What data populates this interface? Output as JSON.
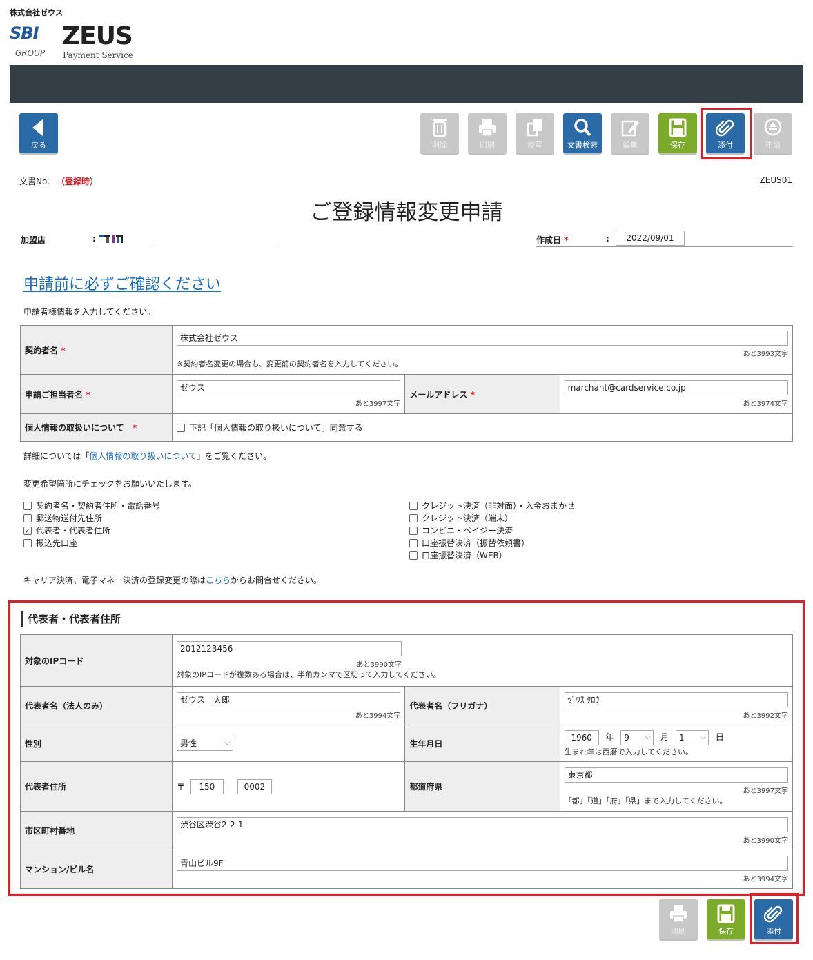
{
  "company": "株式会社ゼウス",
  "logo": {
    "sbi": "SBI",
    "group": "GROUP",
    "zeus": "ZEUS",
    "payment": "Payment Service"
  },
  "toolbar": {
    "back": "戻る",
    "delete": "削除",
    "print": "印刷",
    "copy": "複写",
    "search": "文書検索",
    "edit": "編集",
    "save": "保存",
    "attach": "添付",
    "apply": "申請"
  },
  "doc": {
    "no_label": "文書No.",
    "no_value": "（登録時）",
    "code": "ZEUS01",
    "title": "ご登録情報変更申請"
  },
  "header_fields": {
    "store_label": "加盟店",
    "colon": ":",
    "created_label": "作成日",
    "required_mark": "*",
    "created_value": "2022/09/01"
  },
  "confirm_link": "申請前に必ずご確認ください",
  "intro": "申請者様情報を入力してください。",
  "applicant": {
    "contract_name_label": "契約者名",
    "contract_name_value": "株式会社ゼウス",
    "contract_name_count": "あと3993文字",
    "contract_name_note": "※契約者名変更の場合も、変更前の契約者名を入力してください。",
    "contact_label": "申請ご担当者名",
    "contact_value": "ゼウス",
    "contact_count": "あと3997文字",
    "email_label": "メールアドレス",
    "email_value": "marchant@cardservice.co.jp",
    "email_count": "あと3974文字",
    "privacy_label": "個人情報の取扱いについて",
    "privacy_check": "下記「個人情報の取り扱いについて」同意する"
  },
  "detail_note": {
    "before": "詳細については「",
    "link": "個人情報の取り扱いについて",
    "after": "」をご覧ください。"
  },
  "check_request": "変更希望箇所にチェックをお願いいたします。",
  "change_options_left": [
    {
      "label": "契約者名・契約者住所・電話番号",
      "checked": false
    },
    {
      "label": "郵送物送付先住所",
      "checked": false
    },
    {
      "label": "代表者・代表者住所",
      "checked": true
    },
    {
      "label": "振込先口座",
      "checked": false
    }
  ],
  "change_options_right": [
    {
      "label": "クレジット決済（非対面）・入金おまかせ",
      "checked": false
    },
    {
      "label": "クレジット決済（端末）",
      "checked": false
    },
    {
      "label": "コンビニ・ペイジー決済",
      "checked": false
    },
    {
      "label": "口座振替決済（振替依頼書）",
      "checked": false
    },
    {
      "label": "口座振替決済（WEB）",
      "checked": false
    }
  ],
  "carrier_note": {
    "before": "キャリア決済、電子マネー決済の登録変更の際は",
    "link": "こちら",
    "after": "からお問合せください。"
  },
  "representative": {
    "section_title": "代表者・代表者住所",
    "ip_label": "対象のIPコード",
    "ip_value": "2012123456",
    "ip_count": "あと3990文字",
    "ip_note": "対象のIPコードが複数ある場合は、半角カンマで区切って入力してください。",
    "name_label": "代表者名（法人のみ）",
    "name_value": "ゼウス　太郎",
    "name_count": "あと3994文字",
    "kana_label": "代表者名（フリガナ）",
    "kana_value": "ｾﾞｳｽ ﾀﾛｳ",
    "kana_count": "あと3992文字",
    "gender_label": "性別",
    "gender_value": "男性",
    "birth_label": "生年月日",
    "birth_year": "1960",
    "year_unit": "年",
    "birth_month": "9",
    "month_unit": "月",
    "birth_day": "1",
    "day_unit": "日",
    "birth_note": "生まれ年は西暦で入力してください。",
    "address_label": "代表者住所",
    "postal_mark": "〒",
    "postal1": "150",
    "postal_dash": "-",
    "postal2": "0002",
    "pref_label": "都道府県",
    "pref_value": "東京都",
    "pref_count": "あと3997文字",
    "pref_note": "「都」「道」「府」「県」まで入力してください。",
    "city_label": "市区町村番地",
    "city_value": "渋谷区渋谷2-2-1",
    "city_count": "あと3990文字",
    "building_label": "マンション/ビル名",
    "building_value": "青山ビル9F",
    "building_count": "あと3994文字"
  },
  "colors": {
    "accent_red": "#e01e28",
    "blue_button": "#2a6aa6",
    "green_button": "#7cab2a",
    "gray_button": "#c8c8c8",
    "topbar": "#333f45",
    "link": "#1a6cc4"
  }
}
